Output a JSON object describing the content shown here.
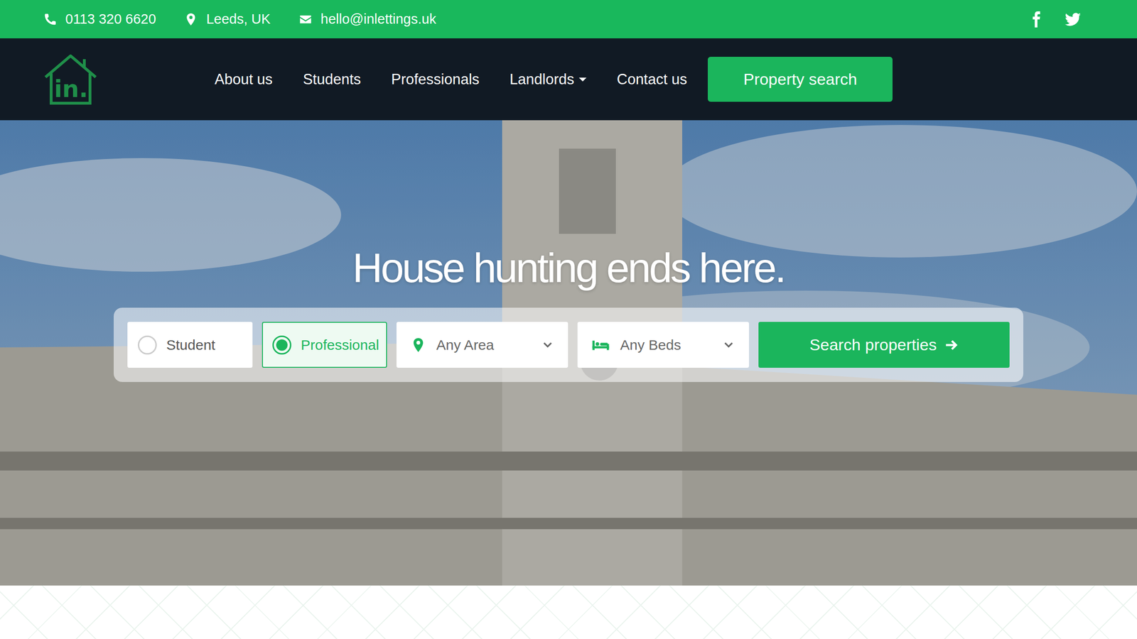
{
  "contact": [
    {
      "kind": "phone",
      "text": "0113 320 6620"
    },
    {
      "kind": "location",
      "text": "Leeds, UK"
    },
    {
      "kind": "email",
      "text": "hello@inlettings.uk"
    }
  ],
  "logo": {
    "text": "in."
  },
  "nav": {
    "items": [
      {
        "label": "About us",
        "has_dropdown": false
      },
      {
        "label": "Students",
        "has_dropdown": false
      },
      {
        "label": "Professionals",
        "has_dropdown": false
      },
      {
        "label": "Landlords",
        "has_dropdown": true
      },
      {
        "label": "Contact us",
        "has_dropdown": false
      }
    ],
    "cta": "Property search"
  },
  "hero": {
    "headline": "House hunting ends here."
  },
  "search": {
    "tenant_types": [
      {
        "label": "Student",
        "selected": false
      },
      {
        "label": "Professional",
        "selected": true
      }
    ],
    "area": {
      "value": "Any Area"
    },
    "beds": {
      "value": "Any Beds"
    },
    "button": {
      "label": "Search properties"
    }
  }
}
